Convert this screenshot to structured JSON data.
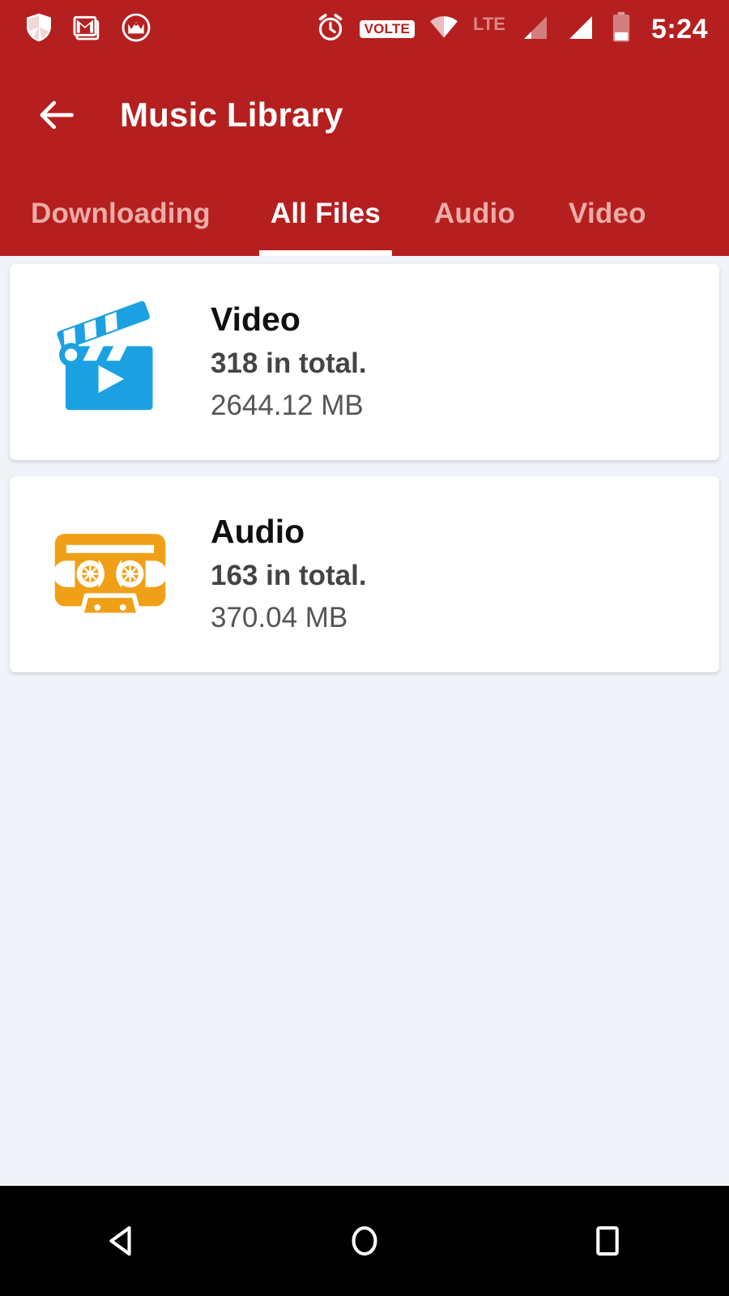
{
  "status_bar": {
    "left_icons": [
      {
        "name": "shield-icon",
        "label": "Shield"
      },
      {
        "name": "gmail-icon",
        "label": "Gmail"
      },
      {
        "name": "crown-circle-icon",
        "label": "Crown"
      }
    ],
    "right_icons": [
      {
        "name": "alarm-clock-icon",
        "label": "Alarm"
      },
      {
        "name": "volte-badge",
        "label": "VOLTE"
      },
      {
        "name": "wifi-icon",
        "label": "Wi-Fi"
      },
      {
        "name": "lte-label",
        "label": "LTE"
      },
      {
        "name": "signal-bars-sim1-icon",
        "label": "Signal 1"
      },
      {
        "name": "signal-bars-sim2-icon",
        "label": "Signal 2"
      },
      {
        "name": "battery-icon",
        "label": "Battery"
      }
    ],
    "volte_text": "VOLTE",
    "lte_text": "LTE",
    "clock": "5:24"
  },
  "app_bar": {
    "back_label": "Back",
    "title": "Music Library"
  },
  "tabs": [
    {
      "label": "Downloading",
      "active": false
    },
    {
      "label": "All Files",
      "active": true
    },
    {
      "label": "Audio",
      "active": false
    },
    {
      "label": "Video",
      "active": false
    }
  ],
  "cards": [
    {
      "icon": "clapperboard-icon",
      "title": "Video",
      "count": "318 in total.",
      "size": "2644.12 MB",
      "color": "#1BA1E2"
    },
    {
      "icon": "cassette-tape-icon",
      "title": "Audio",
      "count": "163 in total.",
      "size": "370.04 MB",
      "color": "#F0A017"
    }
  ],
  "nav_bar": {
    "back_label": "Back",
    "home_label": "Home",
    "recents_label": "Recents"
  },
  "colors": {
    "primary_red": "#B51F1F",
    "background": "#F0F3F8",
    "card_background": "#FFFFFF",
    "tab_inactive": "#ECADA8",
    "video_blue": "#1BA1E2",
    "audio_orange": "#F0A017"
  }
}
